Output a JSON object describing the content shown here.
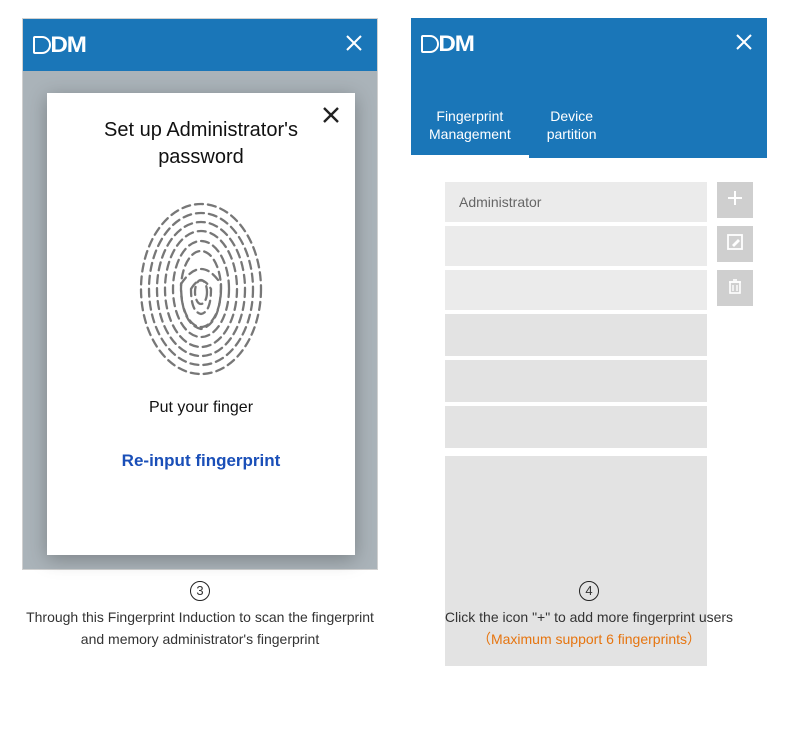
{
  "brand": "DM",
  "left": {
    "dialog_title": "Set up  Administrator's password",
    "instruction": "Put your  finger",
    "reinput": "Re-input fingerprint"
  },
  "right": {
    "tabs": [
      {
        "label_line1": "Fingerprint",
        "label_line2": "Management",
        "active": true
      },
      {
        "label_line1": "Device",
        "label_line2": "partition",
        "active": false
      }
    ],
    "rows": [
      "Administrator"
    ]
  },
  "captions": {
    "left": {
      "step": "3",
      "text": "Through this  Fingerprint Induction to scan the fingerprint and memory administrator's fingerprint"
    },
    "right": {
      "step": "4",
      "text": "Click  the icon \"+\" to add more fingerprint users",
      "note": "（Maximum support 6 fingerprints）"
    }
  }
}
